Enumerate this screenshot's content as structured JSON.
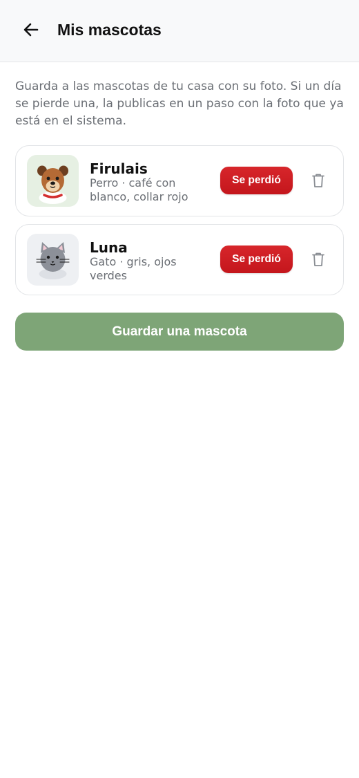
{
  "header": {
    "back_icon": "arrow-left-icon",
    "title": "Mis mascotas"
  },
  "intro": "Guarda a las mascotas de tu casa con su foto. Si un día se pierde una, la publicas en un paso con la foto que ya está en el sistema.",
  "pets": [
    {
      "name": "Firulais",
      "description": "Perro · café con blanco, collar rojo",
      "thumbnail_icon": "dog-icon",
      "lost_label": "Se perdió",
      "delete_icon": "trash-icon"
    },
    {
      "name": "Luna",
      "description": "Gato · gris, ojos verdes",
      "thumbnail_icon": "cat-icon",
      "lost_label": "Se perdió",
      "delete_icon": "trash-icon"
    }
  ],
  "save_button_label": "Guardar una mascota",
  "colors": {
    "lost_button": "#c9191e",
    "save_button": "#7ea577",
    "header_bg": "#f8f9fa"
  }
}
